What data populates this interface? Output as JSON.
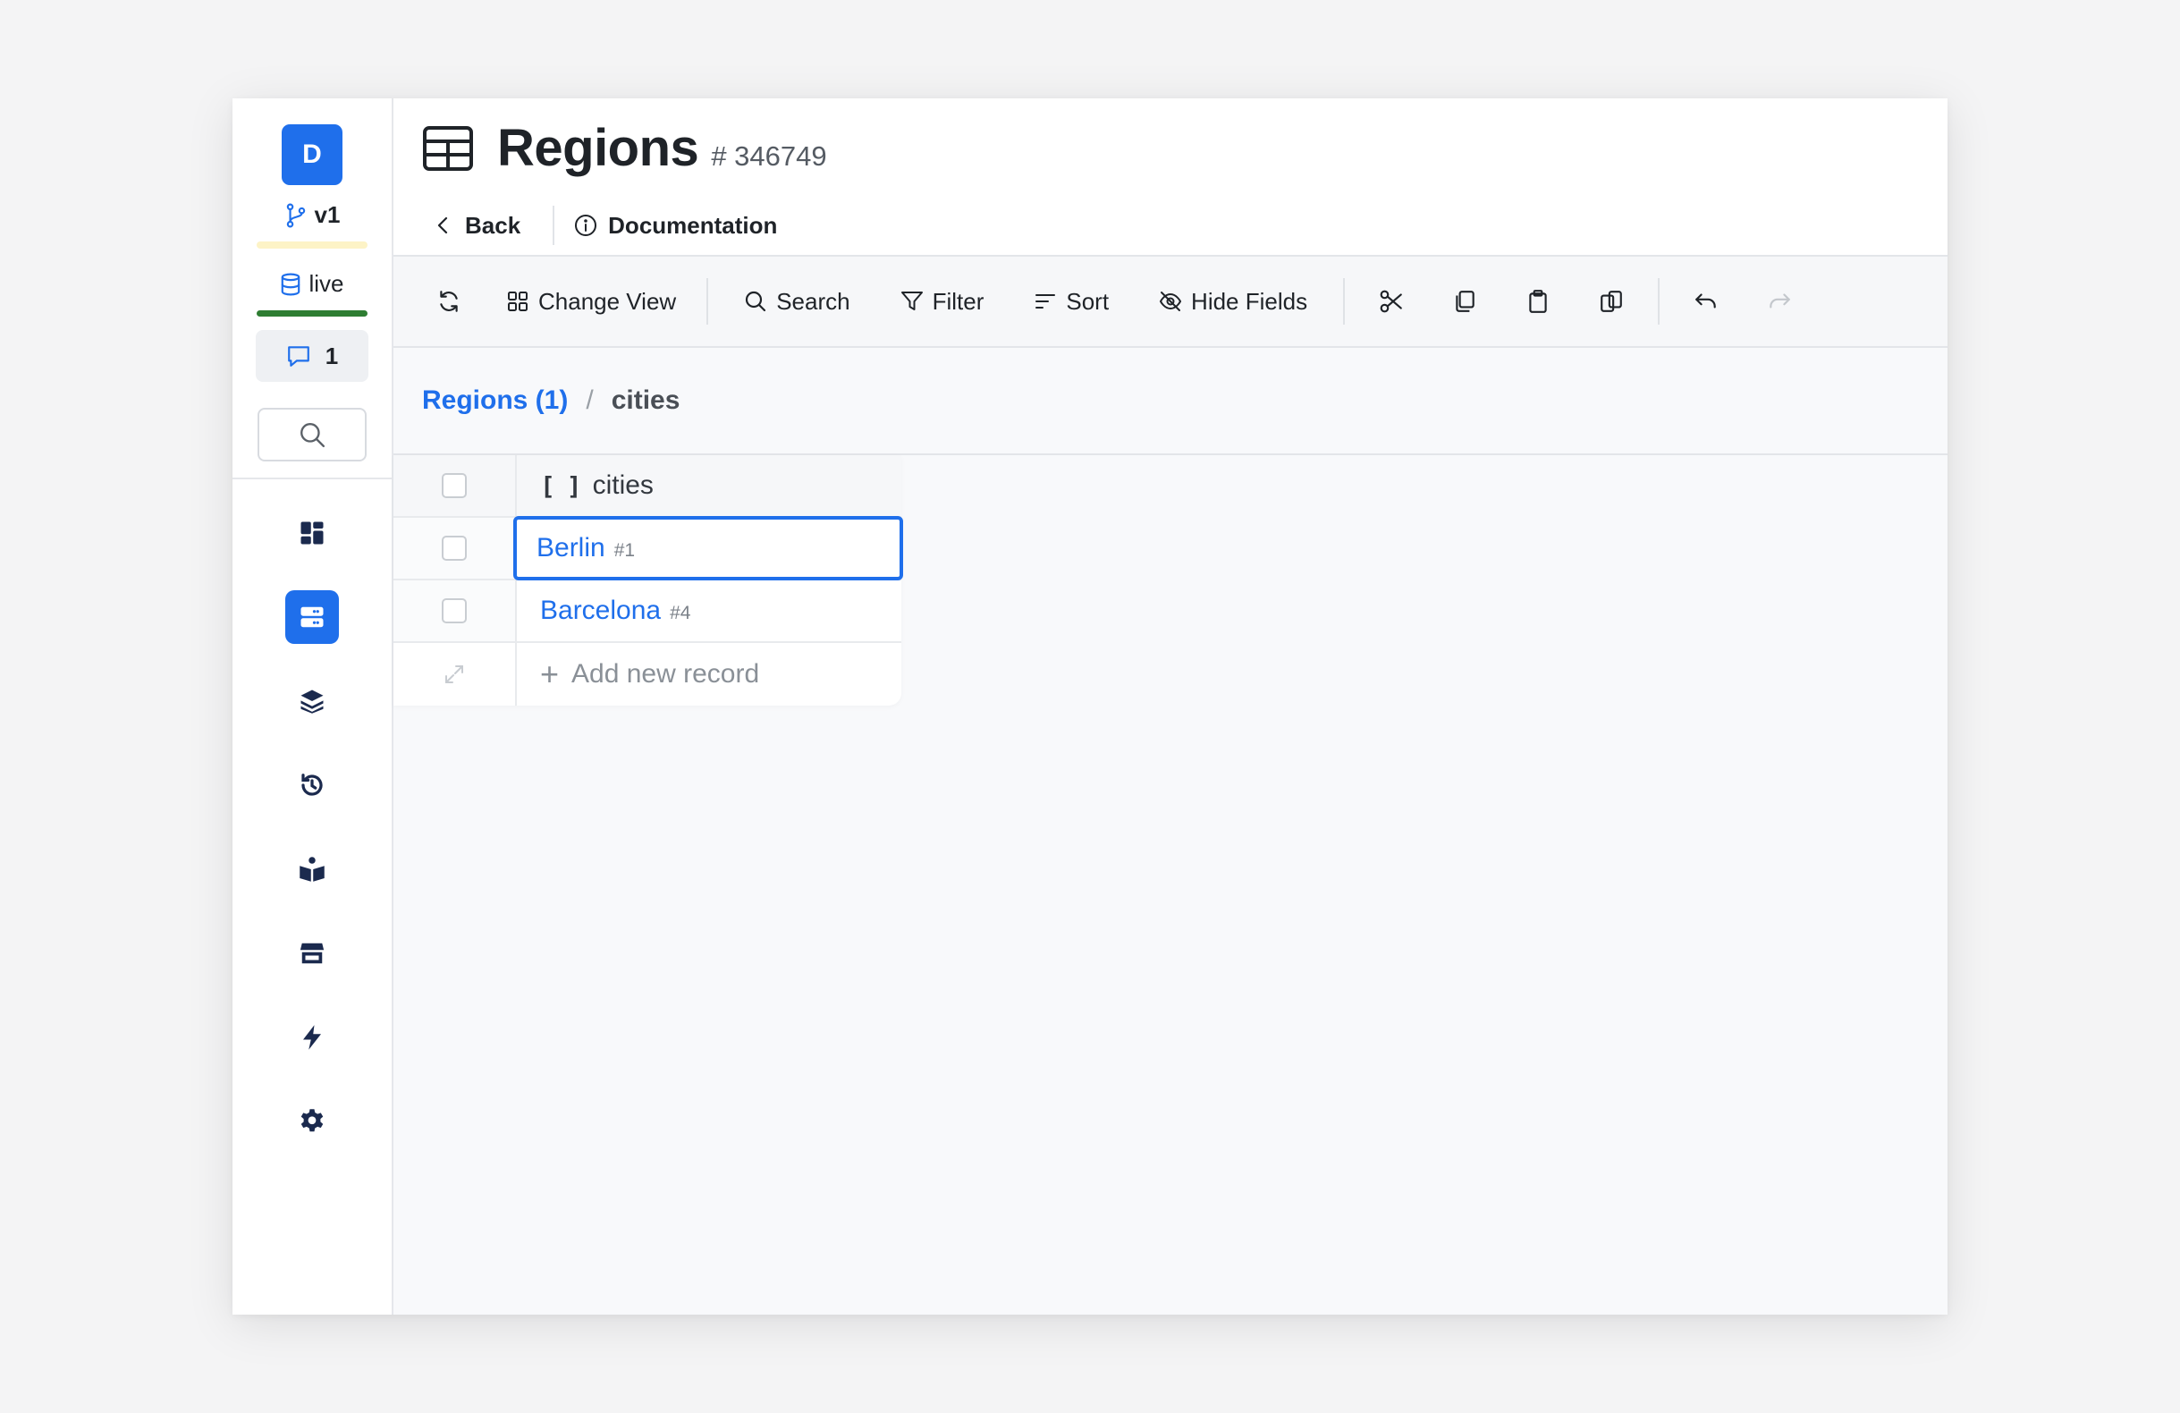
{
  "sidebar": {
    "avatar_letter": "D",
    "branch": "v1",
    "environment": "live",
    "comment_count": "1",
    "nav": [
      "dashboard-icon",
      "content-icon",
      "schema-icon",
      "history-icon",
      "docs-icon",
      "marketplace-icon",
      "webhooks-icon",
      "settings-icon"
    ],
    "active_nav": "content-icon"
  },
  "header": {
    "title": "Regions",
    "record_id": "# 346749",
    "back_label": "Back",
    "documentation_label": "Documentation"
  },
  "toolbar": {
    "change_view": "Change View",
    "search": "Search",
    "filter": "Filter",
    "sort": "Sort",
    "hide_fields": "Hide Fields"
  },
  "breadcrumb": {
    "parent": "Regions (1)",
    "separator": "/",
    "current": "cities"
  },
  "grid": {
    "column": "cities",
    "rows": [
      {
        "name": "Berlin",
        "id": "#1"
      },
      {
        "name": "Barcelona",
        "id": "#4"
      }
    ],
    "add_label": "Add new record"
  },
  "colors": {
    "accent": "#1f6feb",
    "live": "#2e7d32",
    "branch_bar": "#fdf3c6"
  }
}
